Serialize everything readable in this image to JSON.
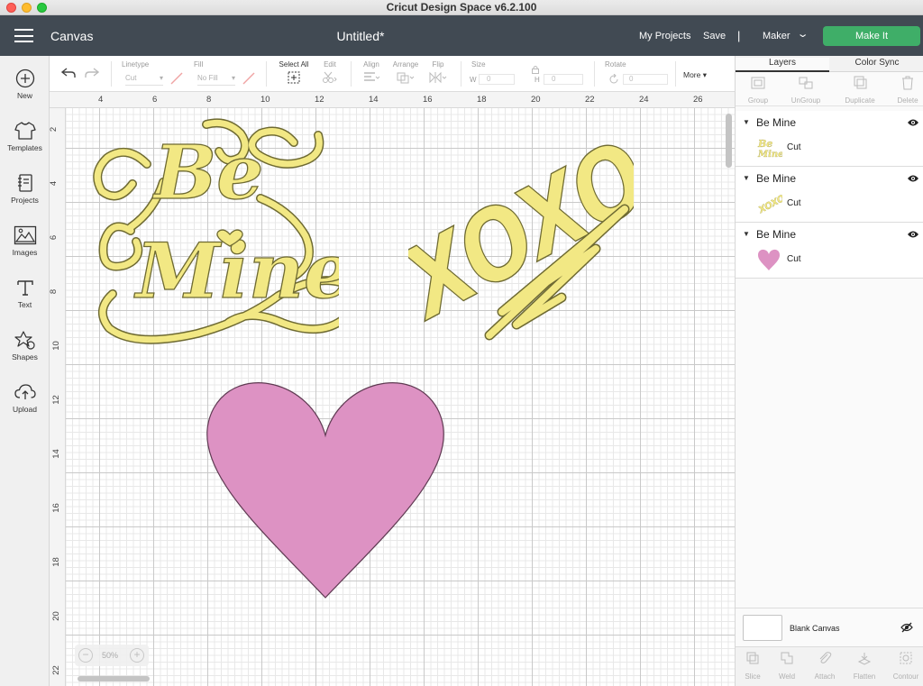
{
  "window": {
    "title": "Cricut Design Space  v6.2.100"
  },
  "header": {
    "section": "Canvas",
    "doc_title": "Untitled*",
    "my_projects": "My Projects",
    "save": "Save",
    "separator": "|",
    "machine": "Maker",
    "make_it": "Make It"
  },
  "leftbar": {
    "items": [
      {
        "label": "New"
      },
      {
        "label": "Templates"
      },
      {
        "label": "Projects"
      },
      {
        "label": "Images"
      },
      {
        "label": "Text"
      },
      {
        "label": "Shapes"
      },
      {
        "label": "Upload"
      }
    ]
  },
  "toolbar": {
    "linetype_label": "Linetype",
    "linetype_value": "Cut",
    "fill_label": "Fill",
    "fill_value": "No Fill",
    "select_all": "Select All",
    "edit": "Edit",
    "align": "Align",
    "arrange": "Arrange",
    "flip": "Flip",
    "size": "Size",
    "w_label": "W",
    "w_value": "0",
    "h_label": "H",
    "h_value": "0",
    "rotate": "Rotate",
    "rotate_value": "0",
    "more": "More ▾"
  },
  "ruler": {
    "top": [
      "4",
      "6",
      "8",
      "10",
      "12",
      "14",
      "16",
      "18",
      "20",
      "22",
      "24",
      "26"
    ],
    "left": [
      "2",
      "4",
      "6",
      "8",
      "10",
      "12",
      "14",
      "16",
      "18",
      "20",
      "22"
    ]
  },
  "canvas": {
    "zoom": "50%",
    "designs": [
      {
        "name": "Be Mine",
        "text_top": "Be",
        "text_bottom": "Mine",
        "color": "#f2e884"
      },
      {
        "name": "XOXO",
        "text": "XOXO",
        "color": "#f2e884"
      },
      {
        "name": "Heart",
        "color": "#dd92c3"
      }
    ]
  },
  "panel": {
    "tabs": [
      "Layers",
      "Color Sync"
    ],
    "tools": [
      "Group",
      "UnGroup",
      "Duplicate",
      "Delete"
    ],
    "layers": [
      {
        "name": "Be Mine",
        "operation": "Cut",
        "thumb": "be-mine",
        "color": "#f2e884"
      },
      {
        "name": "Be Mine",
        "operation": "Cut",
        "thumb": "xoxo",
        "color": "#f2e884"
      },
      {
        "name": "Be Mine",
        "operation": "Cut",
        "thumb": "heart",
        "color": "#dd92c3"
      }
    ],
    "blank_canvas": "Blank Canvas",
    "bottom_tools": [
      "Slice",
      "Weld",
      "Attach",
      "Flatten",
      "Contour"
    ]
  },
  "colors": {
    "header_bg": "#414a53",
    "make_it": "#3fae68",
    "yellow": "#f2e884",
    "pink": "#dd92c3"
  }
}
